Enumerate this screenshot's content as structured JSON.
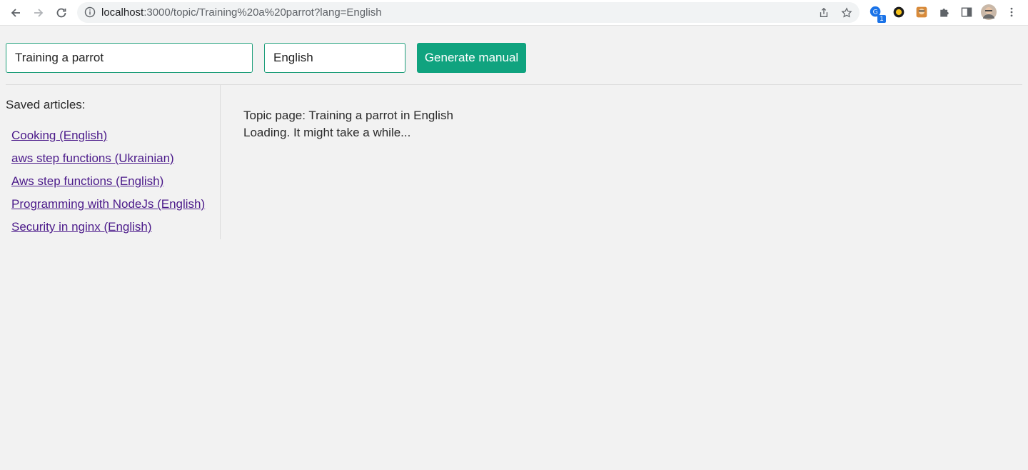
{
  "browser": {
    "url_host": "localhost",
    "url_path": ":3000/topic/Training%20a%20parrot?lang=English",
    "extension_badge": "1"
  },
  "form": {
    "topic_value": "Training a parrot",
    "language_value": "English",
    "generate_label": "Generate manual"
  },
  "sidebar": {
    "heading": "Saved articles:",
    "articles": [
      "Cooking (English)",
      "aws step functions (Ukrainian)",
      "Aws step functions (English)",
      "Programming with NodeJs (English)",
      "Security in nginx (English)"
    ]
  },
  "main": {
    "topic_text": "Topic page: Training a parrot in English",
    "status_text": "Loading. It might take a while..."
  },
  "colors": {
    "accent": "#10a37f",
    "link": "#4b1a8a",
    "background": "#f2f2f2"
  },
  "icons": [
    "back-arrow-icon",
    "forward-arrow-icon",
    "reload-icon",
    "info-icon",
    "share-icon",
    "star-icon",
    "translate-extension-icon",
    "yellow-extension-icon",
    "avatar-extension-icon",
    "puzzle-icon",
    "side-panel-icon",
    "profile-avatar",
    "kebab-menu-icon"
  ]
}
